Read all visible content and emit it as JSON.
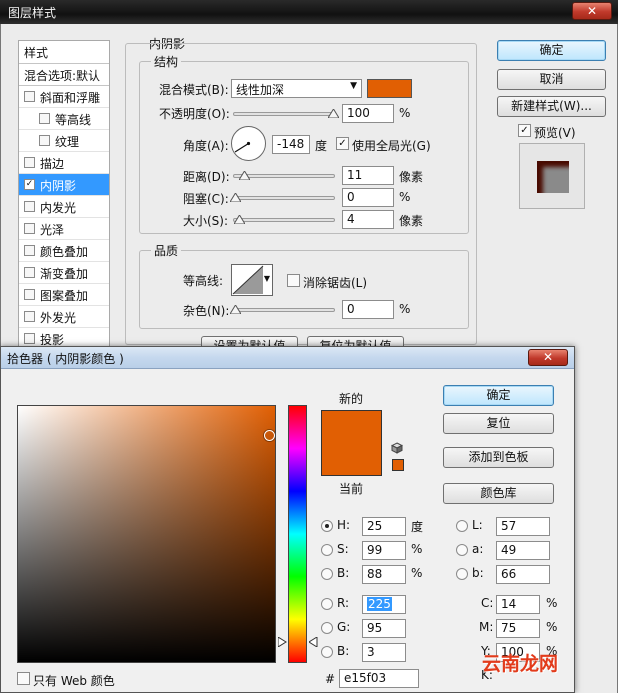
{
  "layer_style": {
    "title": "图层样式",
    "styles_header": "样式",
    "blend_options": "混合选项:默认",
    "styles": [
      {
        "label": "斜面和浮雕",
        "checked": false,
        "sub": false
      },
      {
        "label": "等高线",
        "checked": false,
        "sub": true
      },
      {
        "label": "纹理",
        "checked": false,
        "sub": true
      },
      {
        "label": "描边",
        "checked": false,
        "sub": false
      },
      {
        "label": "内阴影",
        "checked": true,
        "sub": false,
        "selected": true
      },
      {
        "label": "内发光",
        "checked": false,
        "sub": false
      },
      {
        "label": "光泽",
        "checked": false,
        "sub": false
      },
      {
        "label": "颜色叠加",
        "checked": false,
        "sub": false
      },
      {
        "label": "渐变叠加",
        "checked": false,
        "sub": false
      },
      {
        "label": "图案叠加",
        "checked": false,
        "sub": false
      },
      {
        "label": "外发光",
        "checked": false,
        "sub": false
      },
      {
        "label": "投影",
        "checked": false,
        "sub": false
      }
    ],
    "section_title": "内阴影",
    "structure": {
      "legend": "结构",
      "blend_mode_label": "混合模式(B):",
      "blend_mode_value": "线性加深",
      "shadow_color": "#e15f03",
      "opacity_label": "不透明度(O):",
      "opacity_value": "100",
      "opacity_fraction": 1.0,
      "percent": "%",
      "angle_label": "角度(A):",
      "angle_value": "-148",
      "degree": "度",
      "global_light_label": "使用全局光(G)",
      "global_light_checked": true,
      "distance_label": "距离(D):",
      "distance_value": "11",
      "choke_label": "阻塞(C):",
      "choke_value": "0",
      "size_label": "大小(S):",
      "size_value": "4",
      "pixels": "像素"
    },
    "quality": {
      "legend": "品质",
      "contour_label": "等高线:",
      "anti_alias_label": "消除锯齿(L)",
      "anti_alias_checked": false,
      "noise_label": "杂色(N):",
      "noise_value": "0",
      "percent": "%"
    },
    "default_buttons": [
      "设置为默认值",
      "复位为默认值"
    ],
    "buttons": {
      "ok": "确定",
      "cancel": "取消",
      "new_style": "新建样式(W)...",
      "preview_label": "预览(V)",
      "preview_checked": true
    }
  },
  "color_picker": {
    "title": "拾色器 ( 内阴影颜色 )",
    "new_label": "新的",
    "current_label": "当前",
    "new_color": "#e15f03",
    "buttons": {
      "ok": "确定",
      "reset": "复位",
      "add_to_swatches": "添加到色板",
      "color_libraries": "颜色库"
    },
    "fields": {
      "H": {
        "label": "H:",
        "value": "25",
        "unit": "度"
      },
      "S": {
        "label": "S:",
        "value": "99",
        "unit": "%"
      },
      "B": {
        "label": "B:",
        "value": "88",
        "unit": "%"
      },
      "R": {
        "label": "R:",
        "value": "225"
      },
      "G": {
        "label": "G:",
        "value": "95"
      },
      "Bl": {
        "label": "B:",
        "value": "3"
      },
      "L": {
        "label": "L:",
        "value": "57"
      },
      "a": {
        "label": "a:",
        "value": "49"
      },
      "b": {
        "label": "b:",
        "value": "66"
      },
      "C": {
        "label": "C:",
        "value": "14",
        "unit": "%"
      },
      "M": {
        "label": "M:",
        "value": "75",
        "unit": "%"
      },
      "Y": {
        "label": "Y:",
        "value": "100",
        "unit": "%"
      },
      "K": {
        "label": "K:"
      }
    },
    "hex_label": "#",
    "hex_value": "e15f03",
    "web_only_label": "只有 Web 颜色",
    "web_only_checked": false
  },
  "watermark": "云南龙网"
}
